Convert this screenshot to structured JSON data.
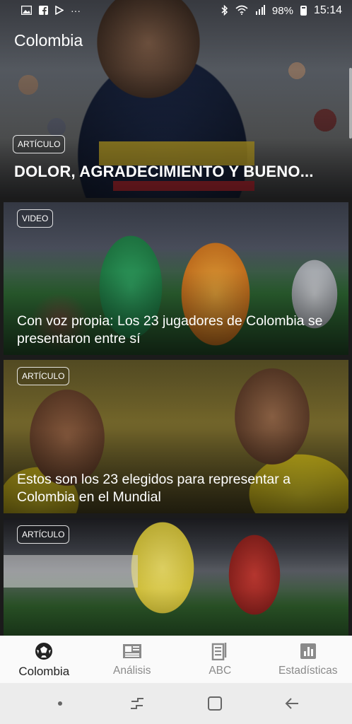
{
  "status_bar": {
    "battery": "98%",
    "time": "15:14",
    "more": "···"
  },
  "app": {
    "title": "Colombia"
  },
  "hero": {
    "badge": "ARTÍCULO",
    "title": "DOLOR, AGRADECIMIENTO Y BUENO..."
  },
  "cards": [
    {
      "badge": "VIDEO",
      "title": "Con voz propia: Los 23 jugadores de Colombia se presentaron entre sí"
    },
    {
      "badge": "ARTÍCULO",
      "title": "Estos son los 23 elegidos para representar a Colombia en el Mundial"
    },
    {
      "badge": "ARTÍCULO",
      "title": ""
    }
  ],
  "bottom_nav": [
    {
      "label": "Colombia",
      "icon": "soccer-ball-icon",
      "active": true
    },
    {
      "label": "Análisis",
      "icon": "newspaper-icon",
      "active": false
    },
    {
      "label": "ABC",
      "icon": "document-icon",
      "active": false
    },
    {
      "label": "Estadísticas",
      "icon": "bar-chart-icon",
      "active": false
    }
  ],
  "colors": {
    "nav_active": "#222222",
    "nav_inactive": "#8a8a8a",
    "nav_bg": "#fafafa"
  }
}
